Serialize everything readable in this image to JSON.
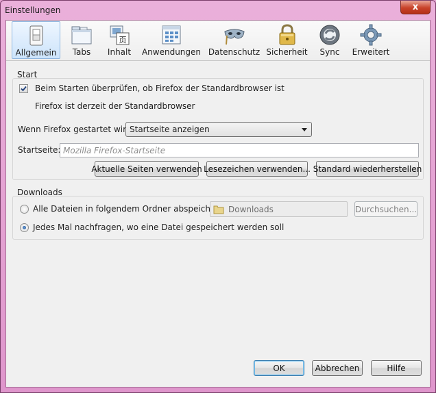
{
  "window": {
    "title": "Einstellungen",
    "close_symbol": "x"
  },
  "tabs": [
    {
      "name": "allgemein",
      "label": "Allgemein",
      "icon": "light-switch-icon"
    },
    {
      "name": "tabs",
      "label": "Tabs",
      "icon": "tabs-window-icon"
    },
    {
      "name": "inhalt",
      "label": "Inhalt",
      "icon": "content-page-icon"
    },
    {
      "name": "anwendungen",
      "label": "Anwendungen",
      "icon": "applications-window-icon"
    },
    {
      "name": "datenschutz",
      "label": "Datenschutz",
      "icon": "privacy-mask-icon"
    },
    {
      "name": "sicherheit",
      "label": "Sicherheit",
      "icon": "padlock-icon"
    },
    {
      "name": "sync",
      "label": "Sync",
      "icon": "sync-arrows-icon"
    },
    {
      "name": "erweitert",
      "label": "Erweitert",
      "icon": "gear-icon"
    }
  ],
  "start": {
    "heading": "Start",
    "check_default_label": "Beim Starten überprüfen, ob Firefox der Standardbrowser ist",
    "check_default_checked": true,
    "default_status": "Firefox ist derzeit der Standardbrowser",
    "when_starts_label": "Wenn Firefox gestartet wird:",
    "when_starts_value": "Startseite anzeigen",
    "homepage_label": "Startseite:",
    "homepage_placeholder": "Mozilla Firefox-Startseite",
    "btn_current": "Aktuelle Seiten verwenden",
    "btn_bookmark": "Lesezeichen verwenden...",
    "btn_restore": "Standard wiederherstellen"
  },
  "downloads": {
    "heading": "Downloads",
    "save_all_label": "Alle Dateien in folgendem Ordner abspeichern:",
    "folder_value": "Downloads",
    "browse_label": "Durchsuchen...",
    "always_ask_label": "Jedes Mal nachfragen, wo eine Datei gespeichert werden soll",
    "selected_option": "always_ask"
  },
  "footer": {
    "ok": "OK",
    "cancel": "Abbrechen",
    "help": "Hilfe"
  },
  "colors": {
    "accent_selected_tab": "#cde4fb",
    "titlebar": "#e6a5d3",
    "close": "#c8432a"
  }
}
